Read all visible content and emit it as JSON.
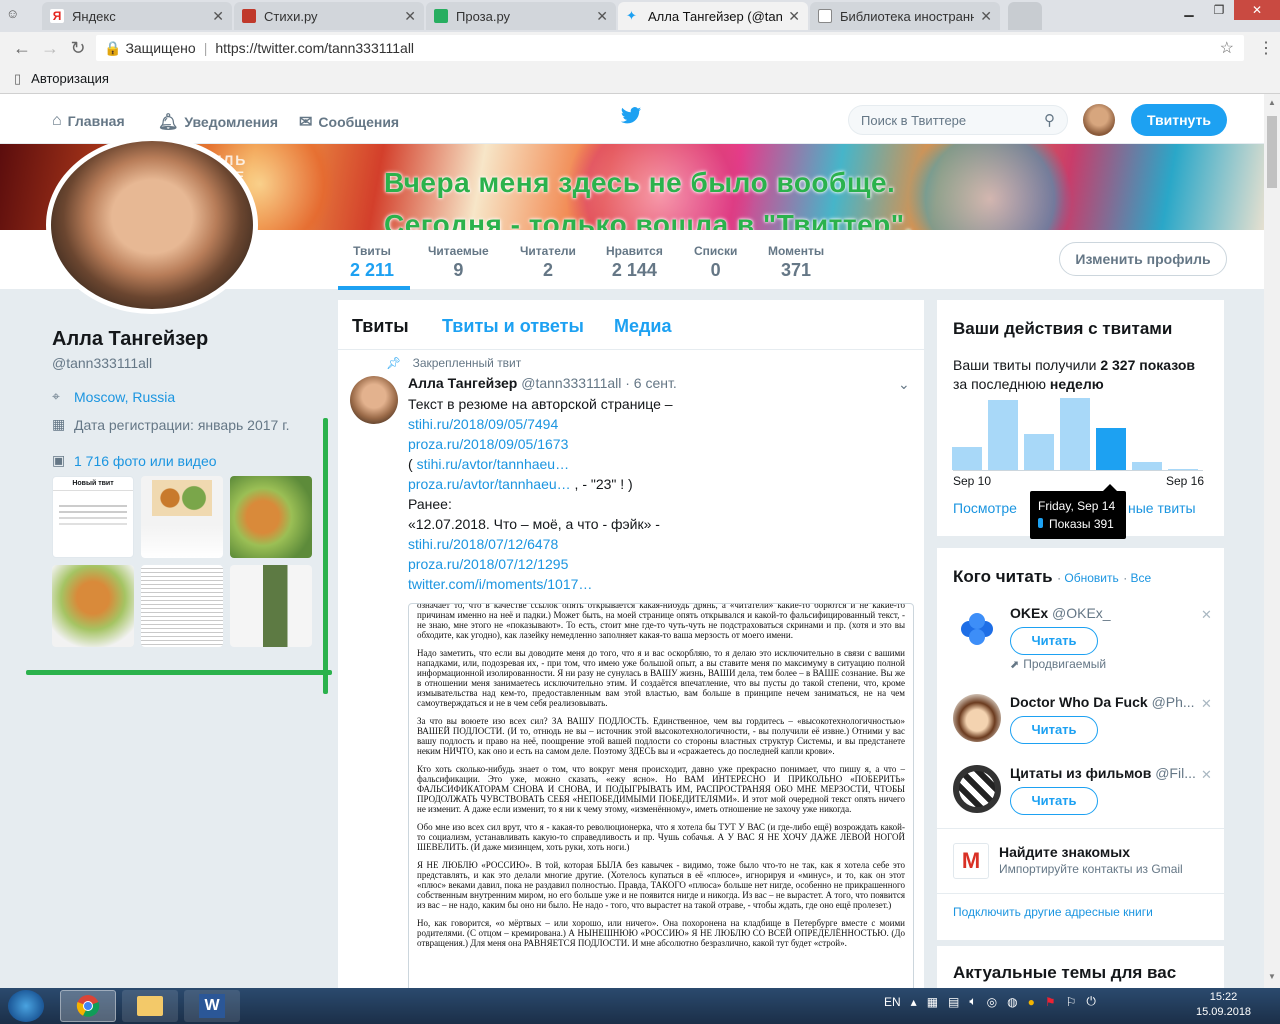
{
  "browser": {
    "tabs": [
      {
        "title": "Яндекс",
        "color": "#f2f2f2",
        "fav": "#ffffff",
        "favText": "Я"
      },
      {
        "title": "Стихи.ру",
        "fav": "#c0392b"
      },
      {
        "title": "Проза.ру",
        "fav": "#27ae60"
      },
      {
        "title": "Алла Тангейзер (@tann3",
        "fav": "#1da1f2",
        "active": true
      },
      {
        "title": "Библиотека иностранно",
        "fav": "#ffffff"
      }
    ],
    "secure_label": "Защищено",
    "url": "https://twitter.com/tann333111all",
    "bookmark": "Авторизация"
  },
  "nav": {
    "home": "Главная",
    "notifications": "Уведомления",
    "messages": "Сообщения",
    "search_placeholder": "Поиск в Твиттере",
    "tweet_button": "Твитнуть"
  },
  "banner_text": [
    "Вчера меня здесь не было вообще.",
    "Сегодня - только вошла в \"Твиттер\"."
  ],
  "stats": [
    {
      "label": "Твиты",
      "value": "2 211"
    },
    {
      "label": "Читаемые",
      "value": "9"
    },
    {
      "label": "Читатели",
      "value": "2"
    },
    {
      "label": "Нравится",
      "value": "2 144"
    },
    {
      "label": "Списки",
      "value": "0"
    },
    {
      "label": "Моменты",
      "value": "371"
    }
  ],
  "edit_profile": "Изменить профиль",
  "profile": {
    "name": "Алла Тангейзер",
    "handle": "@tann333111all",
    "location": "Moscow, Russia",
    "joined": "Дата регистрации: январь 2017 г.",
    "media": "1 716 фото или видео",
    "thumb_label": "Новый твит"
  },
  "timeline": {
    "tabs": [
      "Твиты",
      "Твиты и ответы",
      "Медиа"
    ],
    "pinned": "Закрепленный твит",
    "author": "Алла Тангейзер",
    "meta": "@tann333111all · 6 сент.",
    "lines": [
      {
        "text": "Текст в резюме на авторской странице –"
      },
      {
        "link": "stihi.ru/2018/09/05/7494"
      },
      {
        "link": "proza.ru/2018/09/05/1673"
      },
      {
        "text": "( ",
        "link": "stihi.ru/avtor/tannhaeu…"
      },
      {
        "link": "proza.ru/avtor/tannhaeu…",
        "text_after": " , - \"23\" ! )"
      },
      {
        "text": "Ранее:"
      },
      {
        "text": "«12.07.2018. Что – моё, а что - фэйк» -"
      },
      {
        "link": "stihi.ru/2018/07/12/6478"
      },
      {
        "link": "proza.ru/2018/07/12/1295"
      },
      {
        "link": "twitter.com/i/moments/1017…"
      }
    ],
    "scan_paragraphs": [
      "означает то, что в качестве ссылок опять открывается какая-нибудь дрянь, а «читатели» какие-то борются и не какие-то причинам именно на неё и падки.) Может быть, на моей странице опять открывался и какой-то фальсифицированный текст, - не знаю, мне этого не «показывают». То есть, стоит мне где-то чуть-чуть не подстраховаться скринами и пр. (хотя и это вы обходите, как угодно), как лазейку немедленно заполняет какая-то ваша мерзость от моего имени.",
      "Надо заметить, что если вы доводите меня до того, что я и вас оскорбляю, то я делаю это исключительно в связи с вашими нападками, или, подозревая их, - при том, что имею уже большой опыт, а вы ставите меня по максимуму в ситуацию полной информационной изолированности. Я ни разу не сунулась в ВАШУ жизнь, ВАШИ дела, тем более – в ВАШЕ сознание. Вы же в отношении меня занимаетесь исключительно этим. И создаётся впечатление, что вы пусты до такой степени, что, кроме измывательства над кем-то, предоставленным вам этой властью, вам больше в принципе нечем заниматься, не на чем самоутверждаться и не в чем себя реализовывать.",
      "За что вы воюете изо всех сил? ЗА ВАШУ ПОДЛОСТЬ. Единственное, чем вы гордитесь – «высокотехнологичностью» ВАШЕЙ ПОДЛОСТИ. (И то, отнюдь не вы – источник этой высокотехнологичности, - вы получили её извне.) Отними у вас вашу подлость и право на неё, поощрение этой вашей подлости со стороны властных структур Системы, и вы предстанете неким НИЧТО, как оно и есть на самом деле. Поэтому ЗДЕСЬ вы и «сражаетесь до последней капли крови».",
      "Кто хоть сколько-нибудь знает о том, что вокруг меня происходит, давно уже прекрасно понимает, что пишу я, а что – фальсификации. Это уже, можно сказать, «ежу ясно». Но ВАМ ИНТЕРЕСНО И ПРИКОЛЬНО «ПОБЕРИТЬ» ФАЛЬСИФИКАТОРАМ СНОВА И СНОВА, И ПОДЫГРЫВАТЬ ИМ, РАСПРОСТРАНЯЯ ОБО МНЕ МЕРЗОСТИ, ЧТОБЫ ПРОДОЛЖАТЬ ЧУВСТВОВАТЬ СЕБЯ «НЕПОБЕДИМЫМИ ПОБЕДИТЕЛЯМИ». И этот мой очередной текст опять ничего не изменит. А даже если изменит, то я ни к чему этому, «изменённому», иметь отношение не захочу уже никогда.",
      "Обо мне изо всех сил врут, что я - какая-то революционерка, что я хотела бы ТУТ У ВАС (и где-либо ещё) возрождать какой-то социализм, устанавливать какую-то справедливость и пр. Чушь собачья. А У ВАС Я НЕ ХОЧУ ДАЖЕ ЛЕВОЙ НОГОЙ ШЕВЕЛИТЬ. (И даже мизинцем, хоть руки, хоть ноги.)",
      "Я НЕ ЛЮБЛЮ «РОССИЮ». В той, которая БЫЛА без кавычек - видимо, тоже было что-то не так, как я хотела себе это представлять, и как это делали многие другие. (Хотелось купаться в её «плюсе», игнорируя и «минус», и то, как он этот «плюс» веками давил, пока не раздавил полностью. Правда, ТАКОГО «плюса» больше нет нигде, особенно не прикрашенного собственным внутренним миром, но его больше уже и не появится нигде и никогда. Из вас – не вырастет. А того, что появится из вас – не надо, каким бы оно ни было. Не надо - того, что вырастет на такой отраве, - чтобы ждать, где оно ещё пролезет.)",
      "Но, как говорится, «о мёртвых – или хорошо, или ничего». Она похоронена на кладбище в Петербурге вместе с моими родителями. (С отцом – кремирована.) А НЫНЕШНЮЮ «РОССИЮ» Я НЕ ЛЮБЛЮ СО ВСЕЙ ОПРЕДЕЛЁННОСТЬЮ. (До отвращения.) Для меня она РАВНЯЕТСЯ ПОДЛОСТИ. И мне абсолютно безразлично, какой тут будет «строй»."
    ]
  },
  "activity": {
    "title": "Ваши действия с твитами",
    "summary_pre": "Ваши твиты получили ",
    "summary_bold": "2 327 показов",
    "summary_mid": "за последнюю ",
    "summary_week": "неделю",
    "chart_data": {
      "type": "bar",
      "categories": [
        "Sep 10",
        "Sep 11",
        "Sep 12",
        "Sep 13",
        "Sep 14",
        "Sep 15",
        "Sep 16"
      ],
      "values": [
        120,
        370,
        190,
        380,
        220,
        40,
        0
      ],
      "highlight_index": 4,
      "highlight_color": "#1da1f2",
      "bar_color": "#a8d8f8"
    },
    "axis_start": "Sep 10",
    "axis_end": "Sep 16",
    "view_link_left": "Посмотре",
    "view_link_right": "ные твиты",
    "tooltip_date": "Friday, Sep 14",
    "tooltip_value": "Показы 391"
  },
  "who_to_follow": {
    "title": "Кого читать",
    "refresh": "Обновить",
    "all": "Все",
    "follow_label": "Читать",
    "promoted": "Продвигаемый",
    "accounts": [
      {
        "name": "OKEx",
        "handle": "@OKEx_"
      },
      {
        "name": "Doctor Who Da Fuck",
        "handle": "@Ph..."
      },
      {
        "name": "Цитаты из фильмов",
        "handle": "@Fil..."
      }
    ],
    "find_friends_title": "Найдите знакомых",
    "find_friends_sub": "Импортируйте контакты из Gmail",
    "connect_more": "Подключить другие адресные книги"
  },
  "trends_title": "Актуальные темы для вас",
  "taskbar": {
    "lang": "EN",
    "time": "15:22",
    "date": "15.09.2018"
  }
}
